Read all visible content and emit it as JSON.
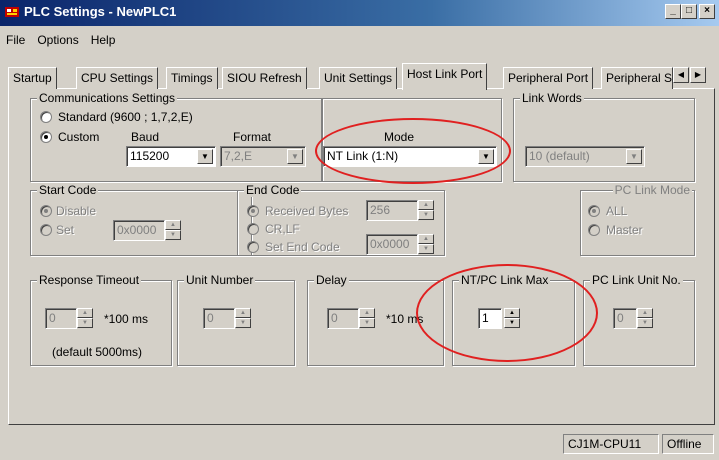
{
  "window": {
    "title": "PLC Settings - NewPLC1",
    "minimize": "_",
    "maximize": "□",
    "close": "×"
  },
  "menu": [
    "File",
    "Options",
    "Help"
  ],
  "tabs": [
    "Startup",
    "CPU Settings",
    "Timings",
    "SIOU Refresh",
    "Unit Settings",
    "Host Link Port",
    "Peripheral Port",
    "Peripheral S"
  ],
  "active_tab": "Host Link Port",
  "comm": {
    "label": "Communications Settings",
    "standard": "Standard (9600 ; 1,7,2,E)",
    "custom": "Custom",
    "baud_label": "Baud",
    "baud_value": "115200",
    "format_label": "Format",
    "format_value": "7,2,E"
  },
  "mode": {
    "label": "Mode",
    "value": "NT Link (1:N)"
  },
  "link_words": {
    "label": "Link Words",
    "value": "10 (default)"
  },
  "start_code": {
    "label": "Start Code",
    "disable": "Disable",
    "set": "Set",
    "value": "0x0000"
  },
  "end_code": {
    "label": "End Code",
    "received_bytes": "Received Bytes",
    "received_value": "256",
    "crlf": "CR,LF",
    "set_end_code": "Set End Code",
    "value": "0x0000"
  },
  "pc_link_mode": {
    "label": "PC Link Mode",
    "all": "ALL",
    "master": "Master"
  },
  "response_timeout": {
    "label": "Response Timeout",
    "value": "0",
    "unit": "*100 ms",
    "note": "(default 5000ms)"
  },
  "unit_number": {
    "label": "Unit Number",
    "value": "0"
  },
  "delay": {
    "label": "Delay",
    "value": "0",
    "unit": "*10 ms"
  },
  "nt_pc_link_max": {
    "label": "NT/PC Link Max",
    "value": "1"
  },
  "pc_link_unit_no": {
    "label": "PC Link Unit No.",
    "value": "0"
  },
  "status": {
    "cpu": "CJ1M-CPU11",
    "mode": "Offline"
  },
  "colors": {
    "annotation": "#e02020",
    "titlebar": "#0a246a"
  }
}
